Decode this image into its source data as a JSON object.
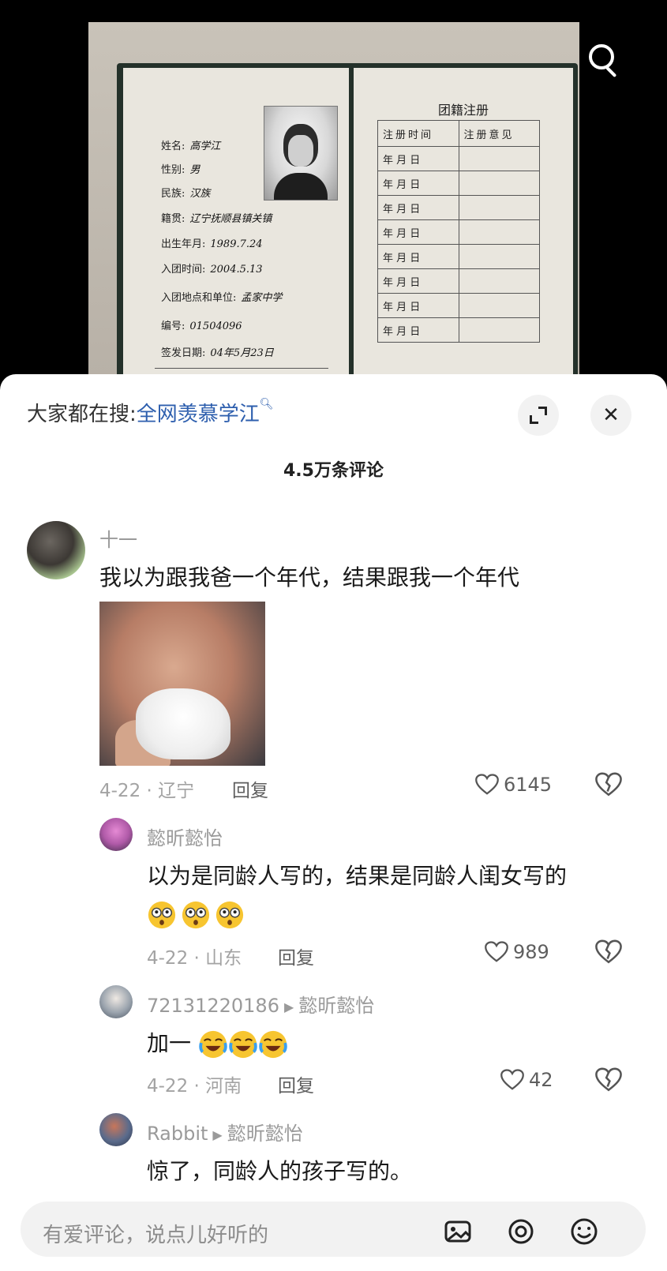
{
  "video": {
    "left_page": {
      "fields": [
        {
          "label": "姓名:",
          "value": "高学江"
        },
        {
          "label": "性别:",
          "value": "男"
        },
        {
          "label": "民族:",
          "value": "汉族"
        },
        {
          "label": "籍贯:",
          "value": "辽宁抚顺县镇关镇"
        },
        {
          "label": "出生年月:",
          "value": "1989.7.24"
        },
        {
          "label": "入团时间:",
          "value": "2004.5.13"
        },
        {
          "label": "入团地点和单位:",
          "value": "孟家中学"
        },
        {
          "label": "编号:",
          "value": "01504096"
        },
        {
          "label": "签发日期:",
          "value": "04年5月23日"
        }
      ]
    },
    "right_page": {
      "title": "团籍注册",
      "col_time": "注册时间",
      "col_opinion": "注册意见",
      "date_row": "年 月 日"
    }
  },
  "sheet": {
    "hot_prefix": "大家都在搜:",
    "hot_keyword": "全网羡慕学江",
    "comment_count": "4.5万条评论",
    "input_placeholder": "有爱评论，说点儿好听的"
  },
  "comments": [
    {
      "user": "十一",
      "text": "我以为跟我爸一个年代，结果跟我一个年代",
      "date_loc": "4-22 · 辽宁",
      "reply": "回复",
      "likes": "6145"
    },
    {
      "user": "懿昕懿怡",
      "text": "以为是同龄人写的，结果是同龄人闺女写的",
      "date_loc": "4-22 · 山东",
      "reply": "回复",
      "likes": "989"
    },
    {
      "user": "72131220186",
      "to": "懿昕懿怡",
      "text": "加一",
      "date_loc": "4-22 · 河南",
      "reply": "回复",
      "likes": "42"
    },
    {
      "user": "Rabbit",
      "to": "懿昕懿怡",
      "text": "惊了，同龄人的孩子写的。"
    }
  ],
  "icons": [
    "search-icon",
    "expand-icon",
    "close-icon",
    "heart-icon",
    "broken-heart-icon",
    "image-icon",
    "emoji-icon",
    "at-icon"
  ],
  "colors": {
    "keyword_link": "#2e5fae",
    "sheet_bg": "#ffffff",
    "video_bg": "#000000"
  }
}
